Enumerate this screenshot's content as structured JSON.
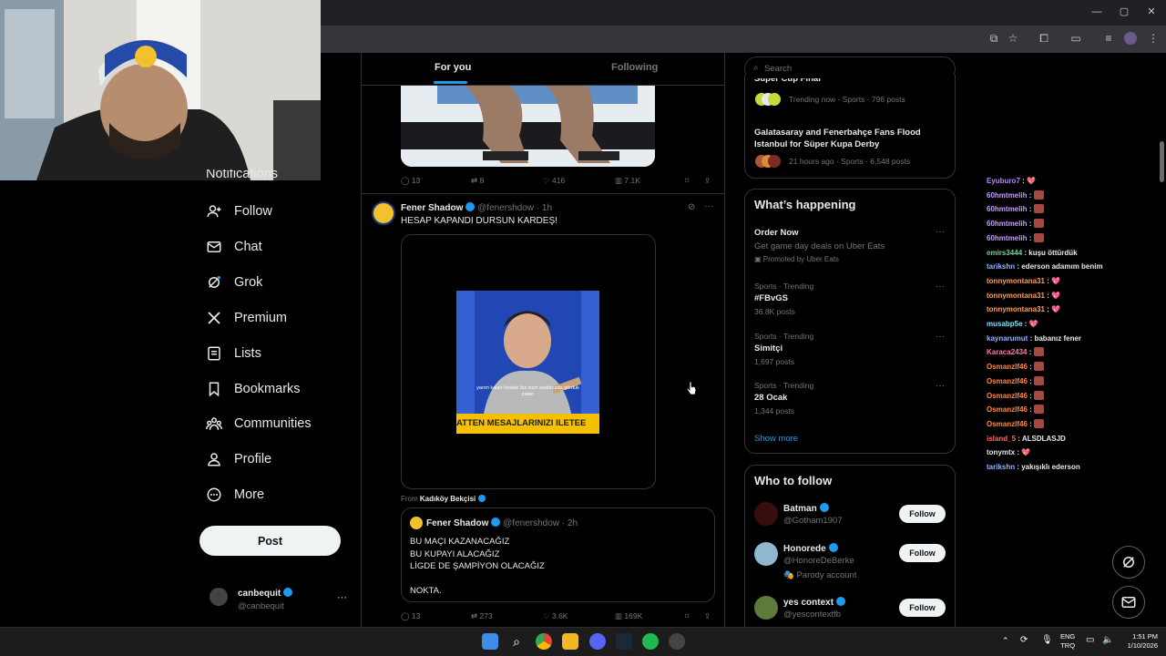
{
  "browser": {
    "window_controls": [
      "—",
      "▢",
      "✕"
    ]
  },
  "tabs": {
    "for_you": "For you",
    "following": "Following"
  },
  "search": {
    "placeholder": "Search"
  },
  "nav": {
    "partial_label": "Notifications",
    "items": [
      {
        "label": "Follow",
        "icon": "follow-icon"
      },
      {
        "label": "Chat",
        "icon": "mail-icon"
      },
      {
        "label": "Grok",
        "icon": "grok-icon"
      },
      {
        "label": "Premium",
        "icon": "x-logo-icon"
      },
      {
        "label": "Lists",
        "icon": "lists-icon"
      },
      {
        "label": "Bookmarks",
        "icon": "bookmark-icon"
      },
      {
        "label": "Communities",
        "icon": "communities-icon"
      },
      {
        "label": "Profile",
        "icon": "profile-icon"
      },
      {
        "label": "More",
        "icon": "more-icon"
      }
    ],
    "post_button": "Post",
    "account": {
      "name": "canbequit",
      "handle": "@canbequit"
    }
  },
  "tweet1_actions": {
    "replies": "13",
    "reposts": "8",
    "likes": "416",
    "views": "7.1K"
  },
  "tweet2": {
    "name": "Fener Shadow",
    "handle": "@fenershdow",
    "time": "· 1h",
    "text": "HESAP KAPANDI DURSUN KARDEŞ!",
    "video_caption": "yarım kalan hesabı biz sizin stadınızda gördük zaten",
    "video_banner": "ATTEN MESAJLARINIZI ILETEE",
    "from_label": "From",
    "from_account": "Kadıköy Bekçisi",
    "quote": {
      "name": "Fener Shadow",
      "handle": "@fenershdow",
      "time": "· 2h",
      "lines": [
        "BU MAÇI KAZANACAĞIZ",
        "BU KUPAYI ALACAĞIZ",
        "LİGDE DE ŞAMPİYON OLACAĞIZ",
        "",
        "NOKTA."
      ]
    },
    "actions": {
      "replies": "13",
      "reposts": "273",
      "likes": "3.6K",
      "views": "169K"
    }
  },
  "news": {
    "partial_title": "Süper Cup Final",
    "first_meta": "Trending now · Sports · 796 posts",
    "second_title": "Galatasaray and Fenerbahçe Fans Flood Istanbul for Süper Kupa Derby",
    "second_meta": "21 hours ago · Sports · 6,548 posts"
  },
  "whats_happening": {
    "title": "What’s happening",
    "promo": {
      "title": "Order Now",
      "desc": "Get game day deals on Uber Eats",
      "promoted": "Promoted by Uber Eats"
    },
    "trends": [
      {
        "meta": "Sports · Trending",
        "title": "#FBvGS",
        "count": "36.8K posts"
      },
      {
        "meta": "Sports · Trending",
        "title": "Simitçi",
        "count": "1,697 posts"
      },
      {
        "meta": "Sports · Trending",
        "title": "28 Ocak",
        "count": "1,344 posts"
      }
    ],
    "show_more": "Show more"
  },
  "who_to_follow": {
    "title": "Who to follow",
    "users": [
      {
        "name": "Batman",
        "handle": "@Gotham1907",
        "extra": "",
        "button": "Follow"
      },
      {
        "name": "Honorede",
        "handle": "@HonoreDeBerke",
        "extra": "Parody account",
        "button": "Follow"
      },
      {
        "name": "yes context",
        "handle": "@yescontextfb",
        "extra": "",
        "button": "Follow"
      }
    ]
  },
  "chat": [
    {
      "user": "Eyuburo7",
      "color": "#b58aff",
      "msg": "",
      "kind": "heart"
    },
    {
      "user": "60hmtmelih",
      "color": "#c79bff",
      "msg": "",
      "kind": "emote"
    },
    {
      "user": "60hmtmelih",
      "color": "#c79bff",
      "msg": "",
      "kind": "emote"
    },
    {
      "user": "60hmtmelih",
      "color": "#c79bff",
      "msg": "",
      "kind": "emote"
    },
    {
      "user": "60hmtmelih",
      "color": "#c79bff",
      "msg": "",
      "kind": "emote"
    },
    {
      "user": "emirs3444",
      "color": "#6fd38b",
      "msg": "kuşu öttürdük",
      "kind": "text"
    },
    {
      "user": "tarikshn",
      "color": "#8fb6ff",
      "msg": "ederson adamım benim",
      "kind": "text"
    },
    {
      "user": "tonnymontana31",
      "color": "#ff9c59",
      "msg": "",
      "kind": "heart"
    },
    {
      "user": "tonnymontana31",
      "color": "#ff9c59",
      "msg": "",
      "kind": "heart"
    },
    {
      "user": "tonnymontana31",
      "color": "#ff9c59",
      "msg": "",
      "kind": "heart"
    },
    {
      "user": "musabp5e",
      "color": "#7fe3ff",
      "msg": "",
      "kind": "heart"
    },
    {
      "user": "kaynarumut",
      "color": "#8fb6ff",
      "msg": "babanız fener",
      "kind": "text"
    },
    {
      "user": "Karaca2434",
      "color": "#ff7aa6",
      "msg": "",
      "kind": "emote"
    },
    {
      "user": "Osmanzlf46",
      "color": "#ff8c42",
      "msg": "",
      "kind": "emote"
    },
    {
      "user": "Osmanzlf46",
      "color": "#ff8c42",
      "msg": "",
      "kind": "emote"
    },
    {
      "user": "Osmanzlf46",
      "color": "#ff8c42",
      "msg": "",
      "kind": "emote"
    },
    {
      "user": "Osmanzlf46",
      "color": "#ff8c42",
      "msg": "",
      "kind": "emote"
    },
    {
      "user": "Osmanzlf46",
      "color": "#ff8c42",
      "msg": "",
      "kind": "emote"
    },
    {
      "user": "island_5",
      "color": "#ff6b6b",
      "msg": "ALSDLASJD",
      "kind": "text"
    },
    {
      "user": "tonymtx",
      "color": "#e6e6e6",
      "msg": "",
      "kind": "heart"
    },
    {
      "user": "tarikshn",
      "color": "#8fb6ff",
      "msg": "yakışıklı ederson",
      "kind": "text"
    }
  ],
  "taskbar": {
    "lang_top": "ENG",
    "lang_bottom": "TRQ",
    "time": "1:51 PM",
    "date": "1/10/2026"
  },
  "colors": {
    "accent": "#1d9bf0",
    "background": "#000000"
  }
}
